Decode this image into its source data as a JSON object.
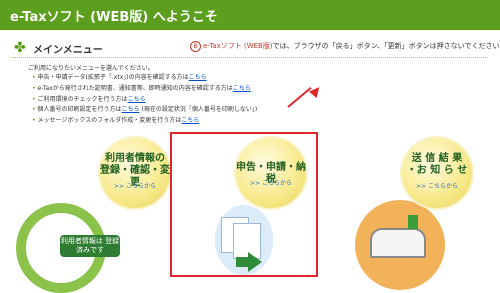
{
  "header": {
    "title": "e-Taxソフト (WEB版) へようこそ"
  },
  "menu": {
    "title": "メインメニュー"
  },
  "notice": {
    "mark": "B",
    "app": "e-Taxソフト (WEB版)",
    "text": "では、ブラウザの「戻る」ボタン、「更新」ボタンは押さないでください。"
  },
  "intro": "ご利用になりたいメニューを選んでください。",
  "links": [
    {
      "text": "申告・申請データ(拡張子「.xtx」)の内容を確認する方は",
      "link": "こちら"
    },
    {
      "text": "e-Taxから発行された証明書、通知書等、即時通知の内容を確認する方は",
      "link": "こちら"
    },
    {
      "text": "ご利用環境のチェックを行う方は",
      "link": "こちら"
    },
    {
      "text": "個人番号の印刷設定を行う方は",
      "link": "こちら",
      "suffix": " (現在の設定状況「個人番号を印刷しない」)"
    },
    {
      "text": "メッセージボックスのフォルダ作成・変更を行う方は",
      "link": "こちら"
    }
  ],
  "panels": {
    "left": {
      "title1": "利用者情報の",
      "title2": "登録・確認・変更",
      "more": ">> こちらから",
      "label": "利用者情報は 登録済みです"
    },
    "mid": {
      "title": "申告・申請・納税",
      "more": ">> こちらから"
    },
    "right": {
      "title1": "送 信 結 果",
      "title2": "・お 知 ら せ",
      "more": ">> こちらから"
    }
  }
}
